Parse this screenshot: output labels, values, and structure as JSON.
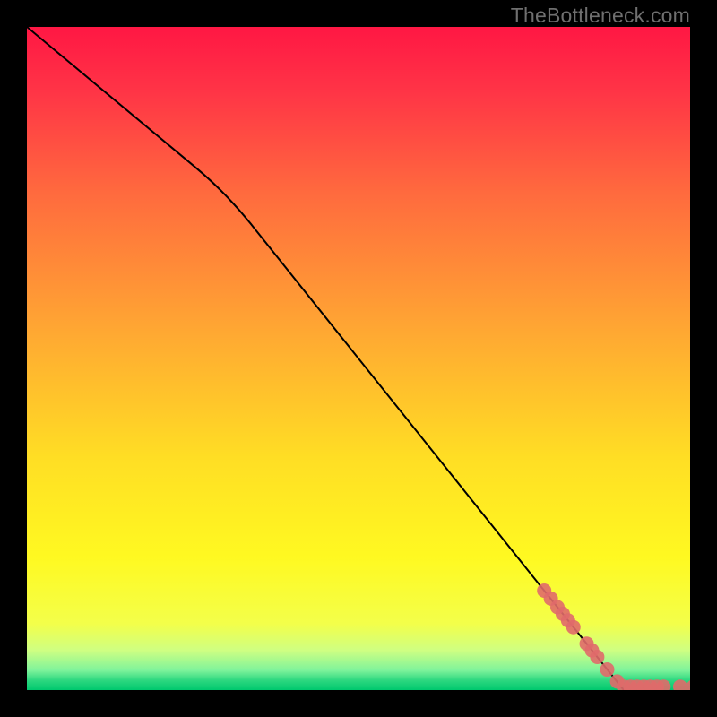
{
  "watermark": "TheBottleneck.com",
  "chart_data": {
    "type": "line",
    "title": "",
    "xlabel": "",
    "ylabel": "",
    "xlim": [
      0,
      100
    ],
    "ylim": [
      0,
      100
    ],
    "grid": false,
    "series": [
      {
        "name": "curve",
        "style": "solid-black",
        "points": [
          {
            "x": 0,
            "y": 100
          },
          {
            "x": 30,
            "y": 75
          },
          {
            "x": 90,
            "y": 0
          }
        ]
      },
      {
        "name": "markers",
        "style": "salmon-dots",
        "points": [
          {
            "x": 78,
            "y": 15.0
          },
          {
            "x": 79,
            "y": 13.8
          },
          {
            "x": 80,
            "y": 12.5
          },
          {
            "x": 80.8,
            "y": 11.5
          },
          {
            "x": 81.6,
            "y": 10.5
          },
          {
            "x": 82.4,
            "y": 9.5
          },
          {
            "x": 84.4,
            "y": 7.0
          },
          {
            "x": 85.2,
            "y": 6.0
          },
          {
            "x": 86.0,
            "y": 5.0
          },
          {
            "x": 87.5,
            "y": 3.1
          },
          {
            "x": 89.0,
            "y": 1.3
          },
          {
            "x": 90.0,
            "y": 0.5
          },
          {
            "x": 91.0,
            "y": 0.5
          },
          {
            "x": 92.0,
            "y": 0.5
          },
          {
            "x": 93.0,
            "y": 0.5
          },
          {
            "x": 94.0,
            "y": 0.5
          },
          {
            "x": 95.0,
            "y": 0.5
          },
          {
            "x": 96.0,
            "y": 0.5
          },
          {
            "x": 98.5,
            "y": 0.5
          },
          {
            "x": 100.5,
            "y": 0.5
          }
        ]
      }
    ],
    "background_gradient": {
      "type": "vertical",
      "stops": [
        {
          "pos": 0.0,
          "color": "#ff1744"
        },
        {
          "pos": 0.1,
          "color": "#ff3546"
        },
        {
          "pos": 0.25,
          "color": "#ff6a3e"
        },
        {
          "pos": 0.45,
          "color": "#ffa533"
        },
        {
          "pos": 0.65,
          "color": "#ffde24"
        },
        {
          "pos": 0.8,
          "color": "#fff921"
        },
        {
          "pos": 0.9,
          "color": "#f3ff4a"
        },
        {
          "pos": 0.94,
          "color": "#cfff82"
        },
        {
          "pos": 0.97,
          "color": "#7ff39b"
        },
        {
          "pos": 0.985,
          "color": "#2ed880"
        },
        {
          "pos": 1.0,
          "color": "#00c86e"
        }
      ]
    }
  }
}
